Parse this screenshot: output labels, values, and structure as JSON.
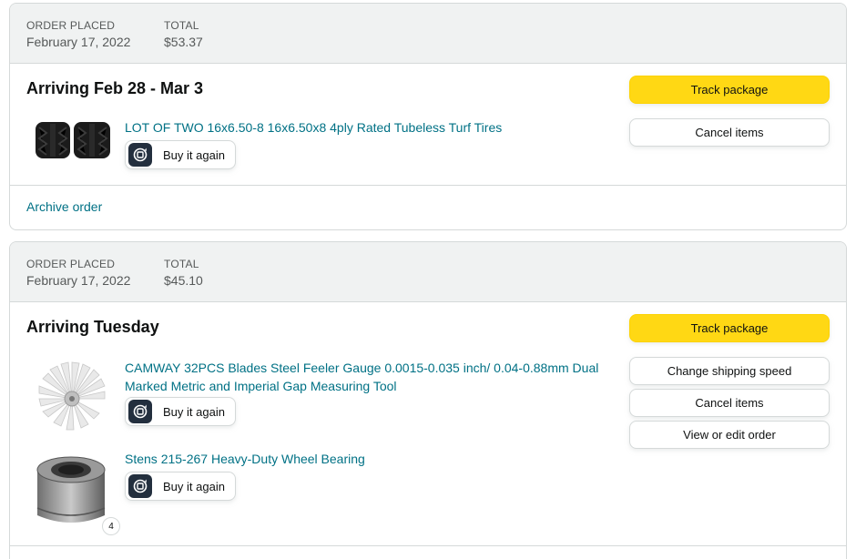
{
  "orders": [
    {
      "placed_label": "ORDER PLACED",
      "placed_date": "February 17, 2022",
      "total_label": "TOTAL",
      "total": "$53.37",
      "status": "Arriving Feb 28 - Mar 3",
      "buttons": {
        "track": "Track package",
        "cancel": "Cancel items"
      },
      "items": [
        {
          "title": "LOT OF TWO 16x6.50-8 16x6.50x8 4ply Rated Tubeless Turf Tires",
          "buy_again": "Buy it again",
          "thumb_icon": "tire-icon"
        }
      ],
      "archive": "Archive order"
    },
    {
      "placed_label": "ORDER PLACED",
      "placed_date": "February 17, 2022",
      "total_label": "TOTAL",
      "total": "$45.10",
      "status": "Arriving Tuesday",
      "buttons": {
        "track": "Track package",
        "change_speed": "Change shipping speed",
        "cancel": "Cancel items",
        "view_edit": "View or edit order"
      },
      "items": [
        {
          "title_line1": "CAMWAY 32PCS Blades Steel Feeler Gauge 0.0015-0.035 inch/ 0.04-0.88mm Dual",
          "title_line2": "Marked Metric and Imperial Gap Measuring Tool",
          "buy_again": "Buy it again",
          "thumb_icon": "feeler-gauge-icon"
        },
        {
          "title": "Stens 215-267 Heavy-Duty Wheel Bearing",
          "buy_again": "Buy it again",
          "thumb_icon": "wheel-bearing-icon",
          "quantity": "4"
        }
      ]
    }
  ],
  "colors": {
    "link": "#007185",
    "primary_button": "#FFD814",
    "header_bg": "#F0F2F2",
    "border": "#D5D9D9"
  }
}
